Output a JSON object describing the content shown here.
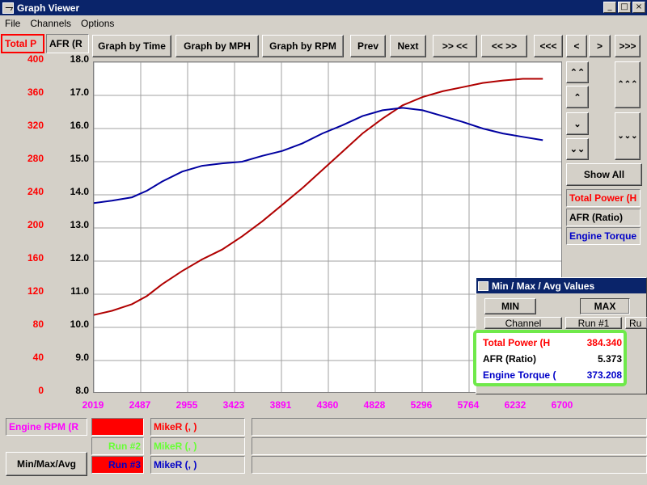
{
  "window": {
    "title": "Graph Viewer"
  },
  "menu": [
    "File",
    "Channels",
    "Options"
  ],
  "channel_tabs": [
    {
      "label": "Total P",
      "color": "#ff0000"
    },
    {
      "label": "AFR (R",
      "color": "#000000"
    }
  ],
  "toolbar": {
    "graph_by_time": "Graph by Time",
    "graph_by_mph": "Graph by MPH",
    "graph_by_rpm": "Graph by RPM",
    "prev": "Prev",
    "next": "Next",
    "zoom_in": ">> <<",
    "zoom_out": "<< >>",
    "first": "<<<",
    "back": "<",
    "forward": ">",
    "last": ">>>"
  },
  "side_buttons": {
    "expand_top": "⌃⌃",
    "up": "⌃",
    "down": "⌄",
    "expand_bottom": "⌄⌄",
    "scroll_up_big": "⌃⌃⌃",
    "scroll_down_big": "⌄⌄⌄",
    "show_all": "Show All"
  },
  "legend": [
    {
      "label": "Total Power (H",
      "color": "#ff0000"
    },
    {
      "label": "AFR (Ratio)",
      "color": "#000000"
    },
    {
      "label": "Engine Torque",
      "color": "#0000c8"
    }
  ],
  "minmax_panel": {
    "title": "Min / Max / Avg Values",
    "min_label": "MIN",
    "max_label": "MAX",
    "channel_header": "Channel",
    "run_header": "Run #1",
    "run_header_partial": "Ru",
    "rows": [
      {
        "name": "Total Power (H",
        "value": "384.340",
        "color": "#ff0000"
      },
      {
        "name": "AFR (Ratio)",
        "value": "5.373",
        "color": "#000000"
      },
      {
        "name": "Engine Torque (",
        "value": "373.208",
        "color": "#0000c8"
      }
    ]
  },
  "bottom": {
    "x_channel": "Engine RPM (R",
    "minmax_button": "Min/Max/Avg",
    "runs": [
      {
        "run_label": "",
        "swatch": "#ff0000",
        "driver": "MikeR (, )",
        "driver_color": "#ff0000"
      },
      {
        "run_label": "Run #2",
        "swatch": "",
        "driver": "MikeR (, )",
        "driver_color": "#66ff33",
        "run_color": "#66ff33"
      },
      {
        "run_label": "Run #3",
        "swatch": "#ff0000",
        "driver": "MikeR (, )",
        "driver_color": "#0000c8",
        "run_color": "#0000c8"
      }
    ]
  },
  "chart_data": {
    "type": "line",
    "x_ticks": [
      "2019",
      "2487",
      "2955",
      "3423",
      "3891",
      "4360",
      "4828",
      "5296",
      "5764",
      "6232",
      "6700"
    ],
    "y_left_ticks": [
      "400",
      "360",
      "320",
      "280",
      "240",
      "200",
      "160",
      "120",
      "80",
      "40",
      "0"
    ],
    "y_right_ticks": [
      "18.0",
      "17.0",
      "16.0",
      "15.0",
      "14.0",
      "13.0",
      "12.0",
      "11.0",
      "10.0",
      "9.0",
      "8.0"
    ],
    "xlim": [
      2019,
      6700
    ],
    "ylim": [
      0,
      400
    ],
    "grid": true,
    "series": [
      {
        "name": "Total Power (H",
        "color": "#b00000",
        "x": [
          2019,
          2200,
          2400,
          2550,
          2700,
          2900,
          3100,
          3300,
          3500,
          3700,
          3900,
          4100,
          4300,
          4500,
          4700,
          4900,
          5100,
          5300,
          5500,
          5700,
          5900,
          6100,
          6300,
          6500
        ],
        "y": [
          95,
          100,
          108,
          118,
          132,
          148,
          162,
          174,
          190,
          208,
          228,
          248,
          270,
          292,
          314,
          332,
          348,
          358,
          365,
          370,
          375,
          378,
          380,
          380
        ]
      },
      {
        "name": "Engine Torque",
        "color": "#0000a0",
        "x": [
          2019,
          2200,
          2400,
          2550,
          2700,
          2900,
          3100,
          3300,
          3500,
          3700,
          3900,
          4100,
          4300,
          4500,
          4700,
          4900,
          5100,
          5300,
          5500,
          5700,
          5900,
          6100,
          6300,
          6500
        ],
        "y": [
          230,
          233,
          237,
          245,
          256,
          268,
          275,
          278,
          280,
          287,
          293,
          302,
          314,
          324,
          335,
          342,
          345,
          342,
          335,
          328,
          320,
          314,
          310,
          306
        ]
      }
    ]
  }
}
